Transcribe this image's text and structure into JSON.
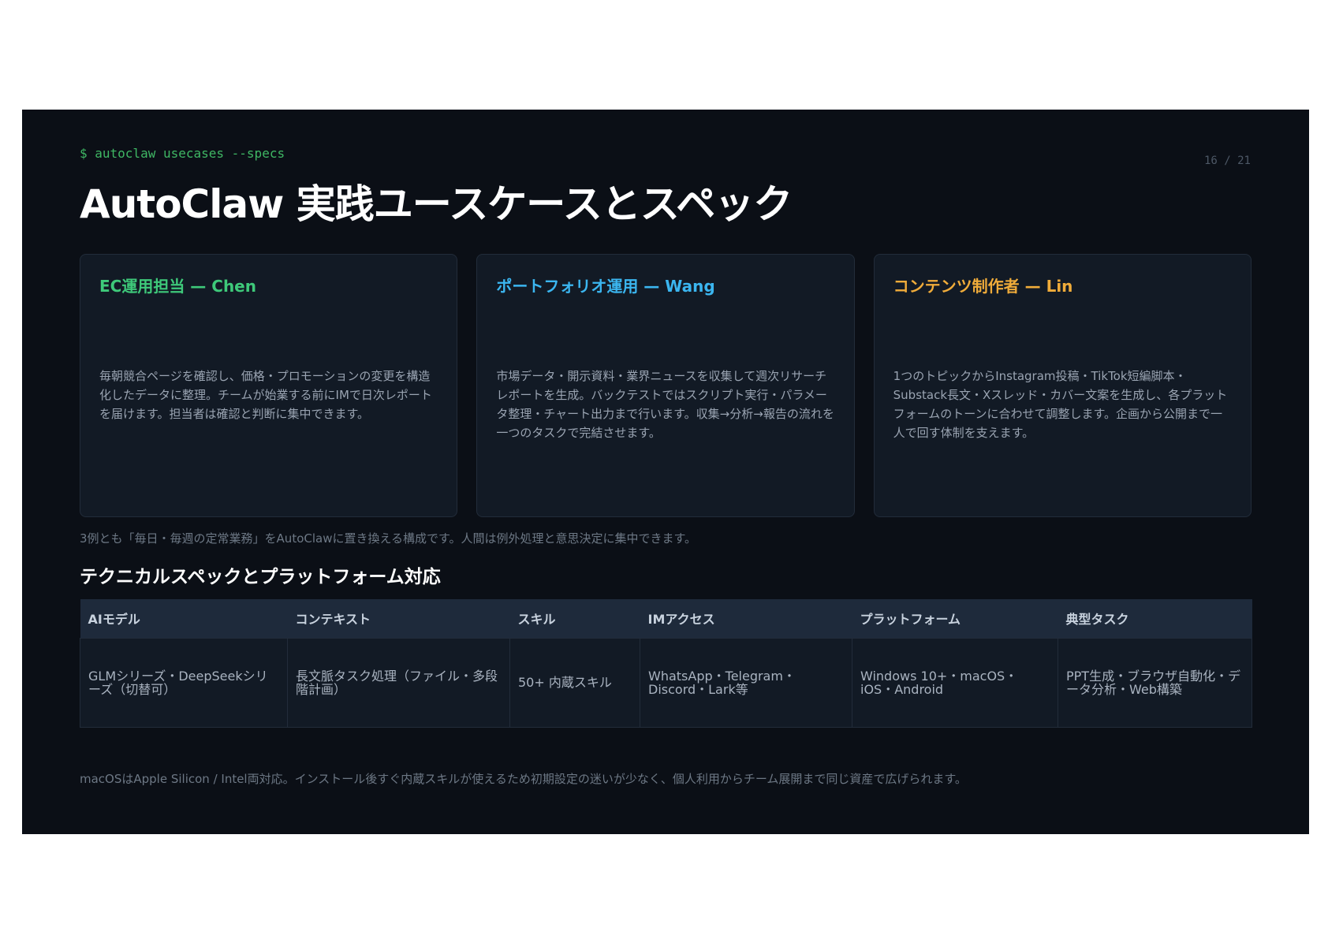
{
  "header": {
    "command": "$ autoclaw usecases --specs",
    "page_indicator": "16 / 21",
    "title": "AutoClaw 実践ユースケースとスペック"
  },
  "cards": [
    {
      "title": "EC運用担当 — Chen",
      "color": "#3ec97a",
      "body": "毎朝競合ページを確認し、価格・プロモーションの変更を構造化したデータに整理。チームが始業する前にIMで日次レポートを届けます。担当者は確認と判断に集中できます。"
    },
    {
      "title": "ポートフォリオ運用 — Wang",
      "color": "#3bb6f0",
      "body": "市場データ・開示資料・業界ニュースを収集して週次リサーチレポートを生成。バックテストではスクリプト実行・パラメータ整理・チャート出力まで行います。収集→分析→報告の流れを一つのタスクで完結させます。"
    },
    {
      "title": "コンテンツ制作者 — Lin",
      "color": "#f0ac3a",
      "body": "1つのトピックからInstagram投稿・TikTok短編脚本・Substack長文・Xスレッド・カバー文案を生成し、各プラットフォームのトーンに合わせて調整します。企画から公開まで一人で回す体制を支えます。"
    }
  ],
  "note": "3例とも「毎日・毎週の定常業務」をAutoClawに置き換える構成です。人間は例外処理と意思決定に集中できます。",
  "spec": {
    "section_title": "テクニカルスペックとプラットフォーム対応",
    "headers": [
      "AIモデル",
      "コンテキスト",
      "スキル",
      "IMアクセス",
      "プラットフォーム",
      "典型タスク"
    ],
    "row": [
      "GLMシリーズ・DeepSeekシリーズ（切替可）",
      "長文脈タスク処理（ファイル・多段階計画）",
      "50+ 内蔵スキル",
      "WhatsApp・Telegram・Discord・Lark等",
      "Windows 10+・macOS・iOS・Android",
      "PPT生成・ブラウザ自動化・データ分析・Web構築"
    ]
  },
  "footer": "macOSはApple Silicon / Intel両対応。インストール後すぐ内蔵スキルが使えるため初期設定の迷いが少なく、個人利用からチーム展開まで同じ資産で広げられます。"
}
